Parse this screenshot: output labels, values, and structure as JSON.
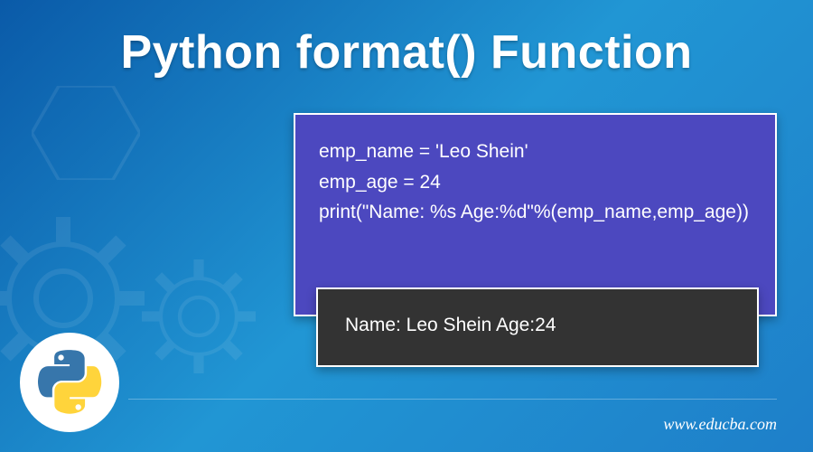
{
  "title": "Python format() Function",
  "code": {
    "line1": "emp_name = 'Leo Shein'",
    "line2": "emp_age = 24",
    "line3": "print(\"Name: %s Age:%d\"%(emp_name,emp_age))"
  },
  "output": "Name: Leo Shein Age:24",
  "website": "www.educba.com",
  "logo_name": "python-logo"
}
